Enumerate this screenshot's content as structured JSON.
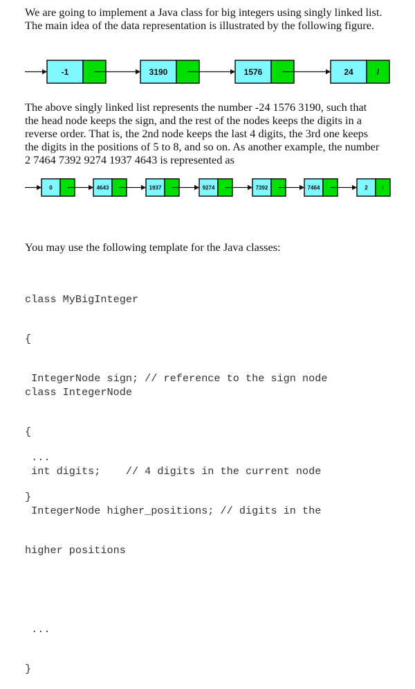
{
  "intro": {
    "line1": "We are going to implement a Java class for big integers using singly linked list.",
    "line2": "The main idea of the data representation is illustrated by the following figure."
  },
  "figure1": {
    "nodes": [
      {
        "value": "-1",
        "pointer": ""
      },
      {
        "value": "3190",
        "pointer": ""
      },
      {
        "value": "1576",
        "pointer": ""
      },
      {
        "value": "24",
        "pointer": "/"
      }
    ],
    "colors": {
      "data": "#80f8ff",
      "pointer": "#00e000",
      "border": "#111111"
    }
  },
  "explanation": {
    "lines": [
      "The above singly linked list represents the number -24 1576 3190, such that",
      "the head node keeps the sign, and the rest of the nodes keeps the digits in a",
      "reverse order. That is, the 2nd node keeps the last 4 digits, the 3rd one keeps",
      "the digits in the positions of 5 to 8, and so on. As another example, the number",
      "2 7464 7392 9274 1937 4643 is represented as"
    ]
  },
  "figure2": {
    "nodes": [
      {
        "value": "0",
        "pointer": ""
      },
      {
        "value": "4643",
        "pointer": ""
      },
      {
        "value": "1937",
        "pointer": ""
      },
      {
        "value": "9274",
        "pointer": ""
      },
      {
        "value": "7392",
        "pointer": ""
      },
      {
        "value": "7464",
        "pointer": ""
      },
      {
        "value": "2",
        "pointer": "/"
      }
    ]
  },
  "template_intro": "You may use the following template for the Java classes:",
  "code1": {
    "lines": [
      "class MyBigInteger",
      "{",
      " IntegerNode sign; // reference to the sign node",
      "",
      " ...",
      "}"
    ]
  },
  "code2": {
    "lines": [
      "class IntegerNode",
      "{",
      " int digits;    // 4 digits in the current node",
      " IntegerNode higher_positions; // digits in the",
      "higher positions",
      "",
      " ...",
      "}"
    ]
  }
}
